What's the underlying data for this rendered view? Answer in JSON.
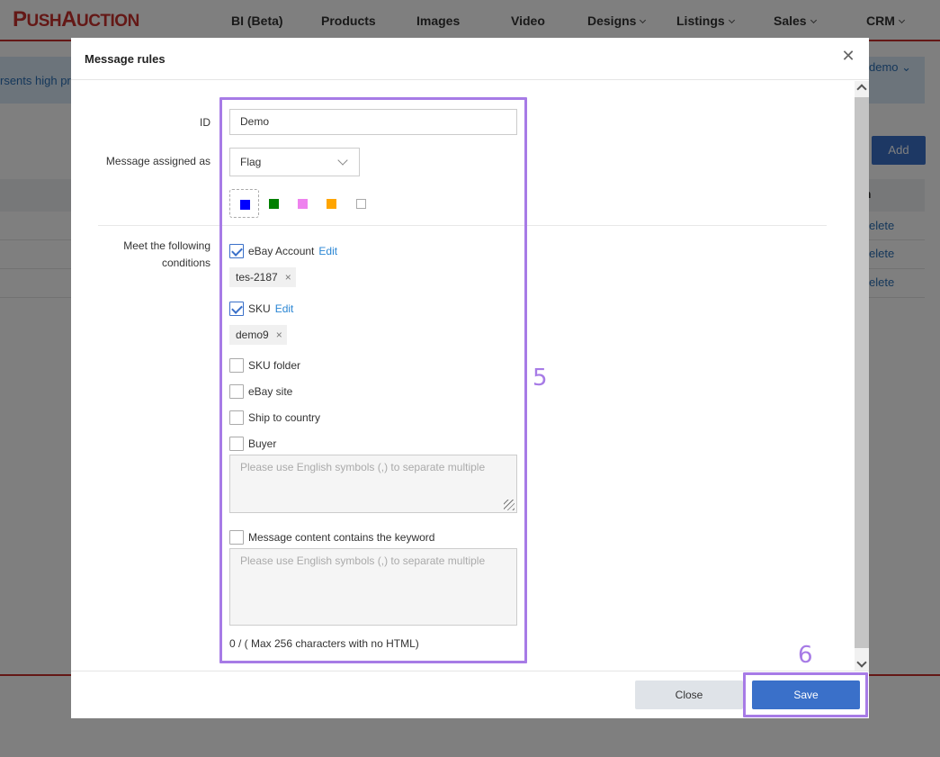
{
  "app": {
    "logo": {
      "p": "P",
      "ush": "USH",
      "a": "A",
      "uction": "UCTION"
    },
    "nav": [
      {
        "label": "BI (Beta)",
        "dropdown": false
      },
      {
        "label": "Products",
        "dropdown": false
      },
      {
        "label": "Images",
        "dropdown": false
      },
      {
        "label": "Video",
        "dropdown": false
      },
      {
        "label": "Designs",
        "dropdown": true
      },
      {
        "label": "Listings",
        "dropdown": true
      },
      {
        "label": "Sales",
        "dropdown": true
      },
      {
        "label": "CRM",
        "dropdown": true
      }
    ],
    "background": {
      "info_text": "rsents high pri",
      "user": "demo",
      "add_button": "Add",
      "table_header_partial": "n",
      "delete_partial": "elete"
    }
  },
  "modal": {
    "title": "Message rules",
    "form": {
      "id_label": "ID",
      "id_value": "Demo",
      "assigned_label": "Message assigned as",
      "assigned_value": "Flag",
      "flag_colors": [
        "#0000ff",
        "#008000",
        "#ee82ee",
        "#ffa500",
        "#ffffff"
      ],
      "conditions_label": "Meet the following conditions",
      "conditions": {
        "ebay_account": {
          "label": "eBay Account",
          "checked": true,
          "edit": "Edit",
          "tag": "tes-2187"
        },
        "sku": {
          "label": "SKU",
          "checked": true,
          "edit": "Edit",
          "tag": "demo9"
        },
        "sku_folder": {
          "label": "SKU folder",
          "checked": false
        },
        "ebay_site": {
          "label": "eBay site",
          "checked": false
        },
        "ship_to_country": {
          "label": "Ship to country",
          "checked": false
        },
        "buyer": {
          "label": "Buyer",
          "checked": false,
          "placeholder": "Please use English symbols (,) to separate multiple"
        },
        "keyword": {
          "label": "Message content contains the keyword",
          "checked": false,
          "placeholder": "Please use English symbols (,) to separate multiple"
        }
      },
      "char_count": "0 / ( Max 256 characters with no HTML)"
    },
    "footer": {
      "close": "Close",
      "save": "Save"
    }
  },
  "annotations": {
    "form_number": "5",
    "save_number": "6",
    "color": "#a77be6"
  }
}
